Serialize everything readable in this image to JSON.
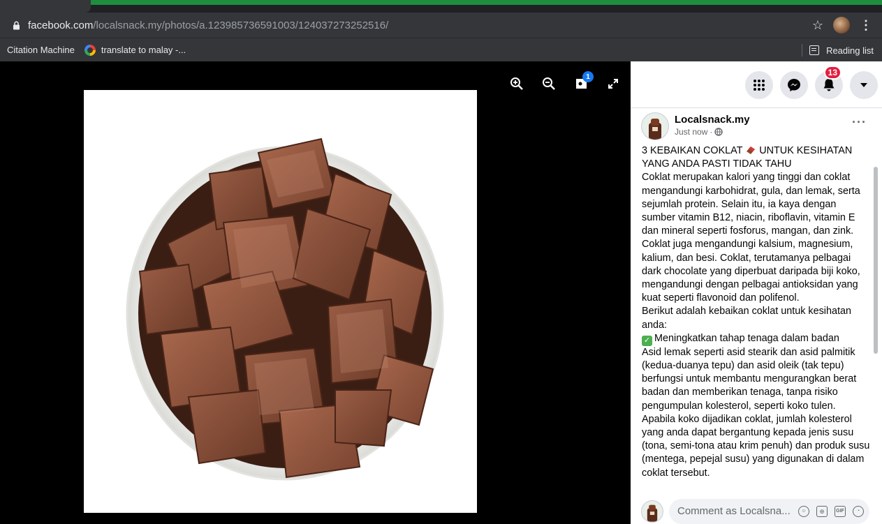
{
  "browser": {
    "url_host": "facebook.com",
    "url_path": "/localsnack.my/photos/a.123985736591003/124037273252516/",
    "bookmarks": [
      {
        "label": "Citation Machine"
      },
      {
        "label": "translate to malay -..."
      }
    ],
    "reading_list_label": "Reading list"
  },
  "viewer": {
    "tag_badge_count": "1"
  },
  "fb_nav": {
    "notifications_count": "13"
  },
  "post": {
    "page_name": "Localsnack.my",
    "time": "Just now",
    "title_part1": "3 KEBAIKAN COKLAT",
    "title_part2": "UNTUK KESIHATAN YANG ANDA PASTI TIDAK TAHU",
    "body": [
      "Coklat merupakan kalori yang tinggi dan coklat mengandungi karbohidrat, gula, dan lemak, serta sejumlah protein. Selain itu, ia kaya dengan sumber vitamin B12, niacin, riboflavin, vitamin E dan mineral seperti fosforus, mangan, dan zink. Coklat juga mengandungi kalsium, magnesium, kalium, dan besi. Coklat, terutamanya pelbagai dark chocolate yang diperbuat daripada biji koko, mengandungi dengan pelbagai antioksidan yang kuat seperti flavonoid dan polifenol.",
      "Berikut adalah kebaikan coklat untuk kesihatan anda:"
    ],
    "benefit_1_title": "Meningkatkan tahap tenaga dalam badan",
    "benefit_1_body": "Asid lemak seperti asid stearik dan asid palmitik (kedua-duanya tepu) dan asid oleik (tak tepu) berfungsi untuk membantu mengurangkan berat badan dan memberikan tenaga, tanpa risiko pengumpulan kolesterol, seperti koko tulen. Apabila koko dijadikan coklat, jumlah kolesterol yang anda dapat bergantung kepada jenis susu (tona, semi-tona atau krim penuh) dan produk susu (mentega, pepejal susu) yang digunakan di dalam coklat tersebut."
  },
  "comment": {
    "placeholder": "Comment as Localsna..."
  }
}
